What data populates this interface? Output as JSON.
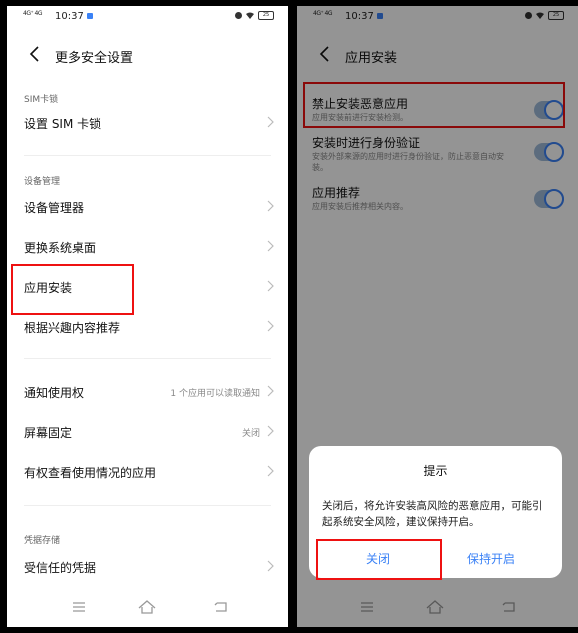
{
  "status_bar": {
    "network": "4G⁺ 4G",
    "time": "10:37",
    "battery": "25"
  },
  "left": {
    "title": "更多安全设置",
    "sections": {
      "sim": "SIM卡锁",
      "device": "设备管理",
      "credentials": "凭据存储"
    },
    "rows": {
      "sim_lock": {
        "label": "设置 SIM 卡锁"
      },
      "device_admin": {
        "label": "设备管理器"
      },
      "change_desktop": {
        "label": "更换系统桌面"
      },
      "app_install": {
        "label": "应用安装"
      },
      "interest_recommend": {
        "label": "根据兴趣内容推荐"
      },
      "notification_access": {
        "label": "通知使用权",
        "value": "1 个应用可以读取通知"
      },
      "screen_pinning": {
        "label": "屏幕固定",
        "value": "关闭"
      },
      "usage_access": {
        "label": "有权查看使用情况的应用"
      },
      "trusted_credentials": {
        "label": "受信任的凭据"
      }
    }
  },
  "right": {
    "title": "应用安装",
    "settings": [
      {
        "label": "禁止安装恶意应用",
        "desc": "应用安装前进行安装检测。",
        "on": true
      },
      {
        "label": "安装时进行身份验证",
        "desc": "安装外部来源的应用时进行身份验证，防止恶意自动安装。",
        "on": true
      },
      {
        "label": "应用推荐",
        "desc": "应用安装后推荐相关内容。",
        "on": true
      }
    ],
    "dialog": {
      "title": "提示",
      "message": "关闭后，将允许安装高风险的恶意应用，可能引起系统安全风险，建议保持开启。",
      "btn_close": "关闭",
      "btn_keep": "保持开启"
    }
  },
  "colors": {
    "accent": "#3b82f6",
    "highlight": "#e11111"
  }
}
